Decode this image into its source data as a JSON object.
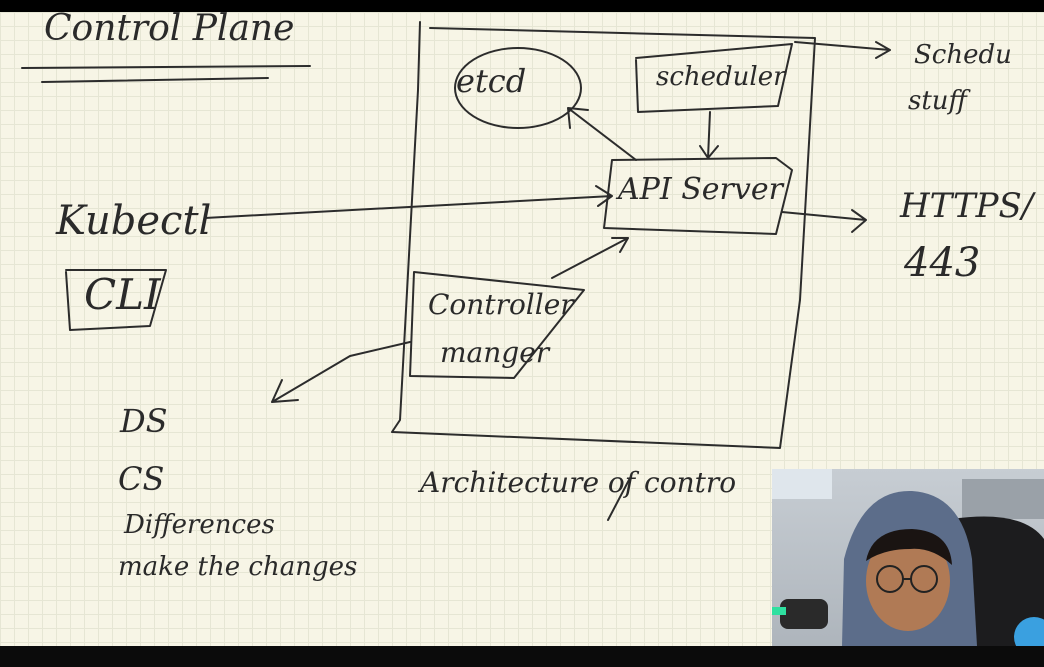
{
  "page": {
    "heading": "Control Plane",
    "components": {
      "etcd": "etcd",
      "scheduler": "scheduler",
      "api_server": "API Server",
      "controller_manager_line1": "Controller",
      "controller_manager_line2": "manger"
    },
    "left": {
      "kubectl": "Kubectl",
      "cli": "CLI"
    },
    "right": {
      "schedule_line1": "Schedu",
      "schedule_line2": "stuff",
      "https": "HTTPS/",
      "port": "443"
    },
    "notes": [
      "DS",
      "CS",
      "Differences",
      "make the changes"
    ],
    "caption": "Architecture of contro"
  },
  "colors": {
    "paper": "#f7f5e6",
    "grid": "#e6e6d4",
    "ink": "#2c2c2c",
    "hoodie": "#5c6d8a",
    "mic_light": "#2fe0a0",
    "logo": "#3aa0e0"
  }
}
